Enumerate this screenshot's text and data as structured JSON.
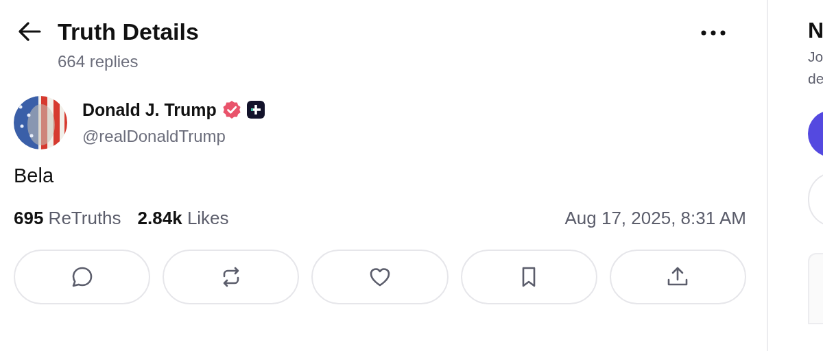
{
  "header": {
    "title": "Truth Details",
    "replies": "664 replies"
  },
  "post": {
    "author": {
      "name": "Donald J. Trump",
      "handle": "@realDonaldTrump",
      "verified": true,
      "plus_member": true
    },
    "text": "Bela",
    "stats": [
      {
        "count": "695",
        "label": "ReTruths"
      },
      {
        "count": "2.84k",
        "label": "Likes"
      }
    ],
    "timestamp": "Aug 17, 2025, 8:31 AM",
    "actions": [
      {
        "kind": "reply"
      },
      {
        "kind": "retruth"
      },
      {
        "kind": "like"
      },
      {
        "kind": "bookmark"
      },
      {
        "kind": "share"
      }
    ]
  },
  "sidebar": {
    "title": "N",
    "lines": [
      "Jo",
      "de"
    ]
  }
}
